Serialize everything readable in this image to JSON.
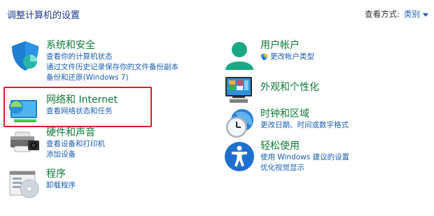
{
  "header": {
    "title": "调整计算机的设置",
    "view_by_label": "查看方式:",
    "view_by_value": "类别"
  },
  "left": [
    {
      "title": "系统和安全",
      "links": [
        "查看你的计算机状态",
        "通过文件历史记录保存你的文件备份副本",
        "备份和还原(Windows 7)"
      ]
    },
    {
      "title": "网络和 Internet",
      "links": [
        "查看网络状态和任务"
      ]
    },
    {
      "title": "硬件和声音",
      "links": [
        "查看设备和打印机",
        "添加设备"
      ]
    },
    {
      "title": "程序",
      "links": [
        "卸载程序"
      ]
    }
  ],
  "right": [
    {
      "title": "用户帐户",
      "links": [
        "更改帐户类型"
      ]
    },
    {
      "title": "外观和个性化",
      "links": []
    },
    {
      "title": "时钟和区域",
      "links": [
        "更改日期、时间或数字格式"
      ]
    },
    {
      "title": "轻松使用",
      "links": [
        "使用 Windows 建议的设置",
        "优化视觉显示"
      ]
    }
  ],
  "icons": {
    "system-security": "shield-icon",
    "network": "network-globe-icon",
    "hardware": "printer-icon",
    "programs": "programs-disc-icon",
    "user-accounts": "user-icon",
    "appearance": "monitor-icon",
    "clock-region": "clock-globe-icon",
    "ease-of-access": "accessibility-icon",
    "uac": "uac-shield-icon"
  },
  "highlight_color": "#d3202a"
}
